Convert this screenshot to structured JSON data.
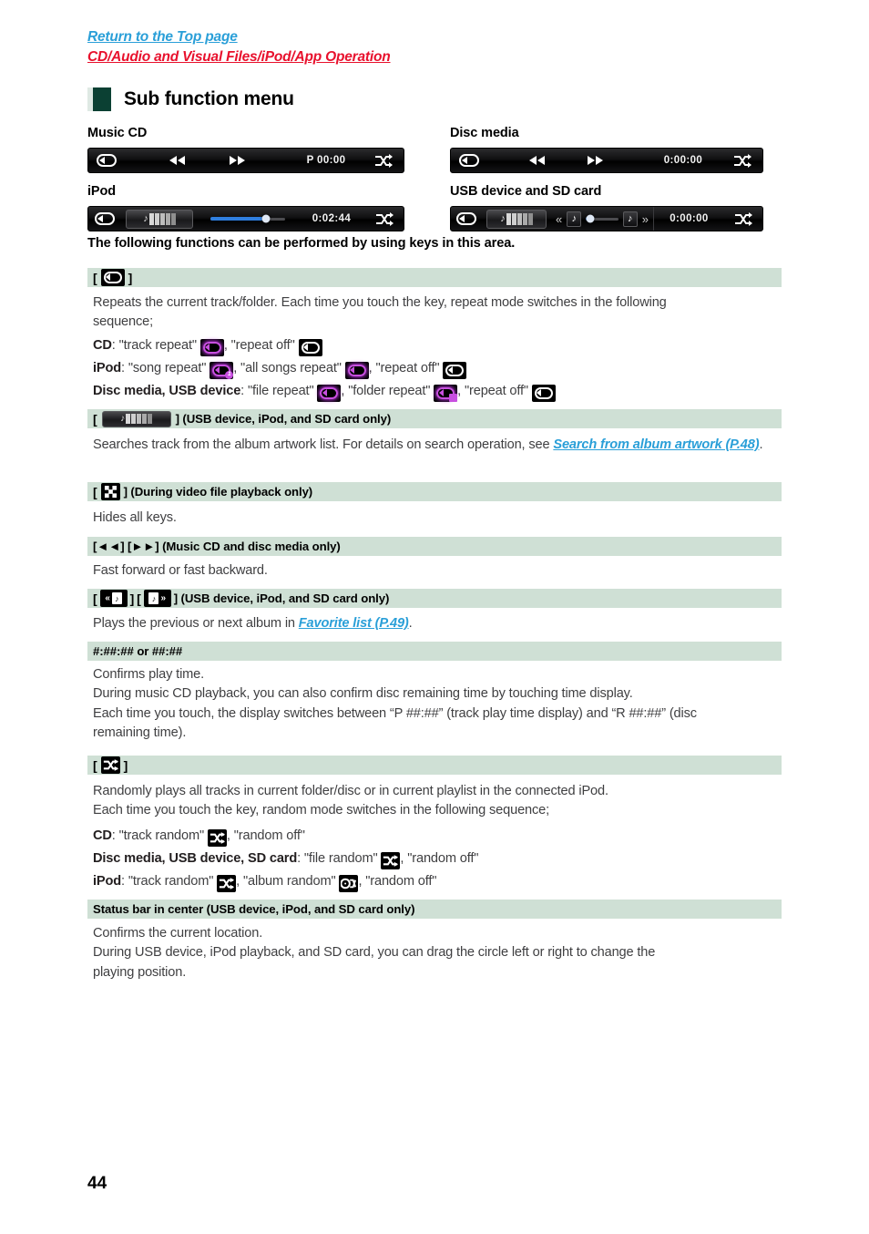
{
  "top_links": [
    {
      "text": "Return to the Top page",
      "color": "#2a9fd8"
    },
    {
      "text": "CD/Audio and Visual Files/iPod/App Operation",
      "color": "#e8112d"
    }
  ],
  "section": {
    "title": "Sub function menu",
    "marker_color": "#0b4033"
  },
  "media_examples": [
    {
      "label": "Music CD",
      "time": "P 00:00"
    },
    {
      "label": "Disc media",
      "time": "0:00:00"
    },
    {
      "label": "iPod",
      "time": "0:02:44"
    },
    {
      "label": "USB device and SD card",
      "time": "0:00:00"
    }
  ],
  "intro": "The following functions can be performed by using keys in this area.",
  "sections": {
    "repeat": {
      "header_prefix": "[",
      "header_suffix": "]",
      "line1": "Repeats the current track/folder. Each time you touch the key, repeat mode switches in the following",
      "line2": "sequence;",
      "cd_label": "CD",
      "cd_a": ": \"track repeat\"",
      "cd_b": ", \"repeat off\"",
      "ipod_label": "iPod",
      "ipod_a": ": \"song repeat\"",
      "ipod_b": ", \"all songs repeat\"",
      "ipod_c": ", \"repeat off\"",
      "disc_label": "Disc media, USB device",
      "disc_a": ": \"file repeat\"",
      "disc_b": ", \"folder repeat\"",
      "disc_c": ", \"repeat off\""
    },
    "artwork": {
      "header_suffix": "] (USB device, iPod, and SD card only)",
      "body_a": "Searches track from the album artwork list. For details on search operation, see ",
      "link": "Search from album artwork (P.48)",
      "body_b": "."
    },
    "hidekeys": {
      "header_suffix": "] (During video file playback only)",
      "body": "Hides all keys."
    },
    "ffrew": {
      "header": "[◄◄] [►►] (Music CD and disc media only)",
      "body": "Fast forward or fast backward."
    },
    "album_nav": {
      "header_suffix": "] (USB device, iPod, and SD card only)",
      "body_a": "Plays the previous or next album in ",
      "link": "Favorite list (P.49)",
      "body_b": "."
    },
    "playtime": {
      "header": "#:##:## or ##:##",
      "line1": "Confirms play time.",
      "line2": "During music CD playback, you can also confirm disc remaining time by touching time display.",
      "line3": "Each time you touch, the display switches between “P ##:##” (track play time display) and “R ##:##” (disc",
      "line4": "remaining time)."
    },
    "random": {
      "line1": "Randomly plays all tracks in current folder/disc or in current playlist in the connected iPod.",
      "line2": "Each time you touch the key, random mode switches in the following sequence;",
      "cd_label": "CD",
      "cd_a": ": \"track random\"",
      "cd_b": ", \"random off\"",
      "disc_label": "Disc media, USB device, SD card",
      "disc_a": ": \"file random\"",
      "disc_b": ", \"random off\"",
      "ipod_label": "iPod",
      "ipod_a": ": \"track random\"",
      "ipod_b": ", \"album random\"",
      "ipod_c": ", \"random off\""
    },
    "statusbar": {
      "header": "Status bar in center (USB device, iPod, and SD card only)",
      "line1": "Confirms the current location.",
      "line2": "During USB device, iPod playback, and SD card, you can drag the circle left or right to change the",
      "line3": "playing position."
    }
  },
  "page_number": "44",
  "colors": {
    "header_band": "#cfe0d5",
    "link_blue": "#2a9fd8",
    "link_red": "#e8112d",
    "repeat_active": "#c84fe0",
    "slider_fill": "#2f7fe0"
  }
}
